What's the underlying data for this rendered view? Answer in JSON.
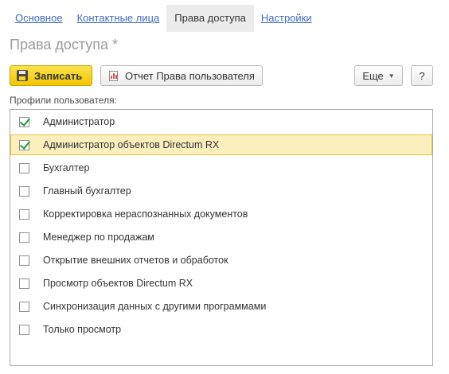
{
  "tabs": [
    {
      "label": "Основное",
      "active": false
    },
    {
      "label": "Контактные лица",
      "active": false
    },
    {
      "label": "Права доступа",
      "active": true
    },
    {
      "label": "Настройки",
      "active": false
    }
  ],
  "page_title": "Права доступа *",
  "toolbar": {
    "save_label": "Записать",
    "report_label": "Отчет Права пользователя",
    "more_label": "Еще",
    "help_label": "?"
  },
  "profiles": {
    "label": "Профили пользователя:",
    "items": [
      {
        "label": "Администратор",
        "checked": true,
        "selected": false
      },
      {
        "label": "Администратор объектов Directum RX",
        "checked": true,
        "selected": true
      },
      {
        "label": "Бухгалтер",
        "checked": false,
        "selected": false
      },
      {
        "label": "Главный бухгалтер",
        "checked": false,
        "selected": false
      },
      {
        "label": "Корректировка нераспознанных документов",
        "checked": false,
        "selected": false
      },
      {
        "label": "Менеджер по продажам",
        "checked": false,
        "selected": false
      },
      {
        "label": "Открытие внешних отчетов и обработок",
        "checked": false,
        "selected": false
      },
      {
        "label": "Просмотр объектов Directum RX",
        "checked": false,
        "selected": false
      },
      {
        "label": "Синхронизация данных с другими программами",
        "checked": false,
        "selected": false
      },
      {
        "label": "Только просмотр",
        "checked": false,
        "selected": false
      }
    ]
  },
  "colors": {
    "link": "#3d6bbf",
    "save_button": "#f2c600",
    "selected_row": "#fbefbd",
    "checkmark": "#1f9a3a"
  }
}
